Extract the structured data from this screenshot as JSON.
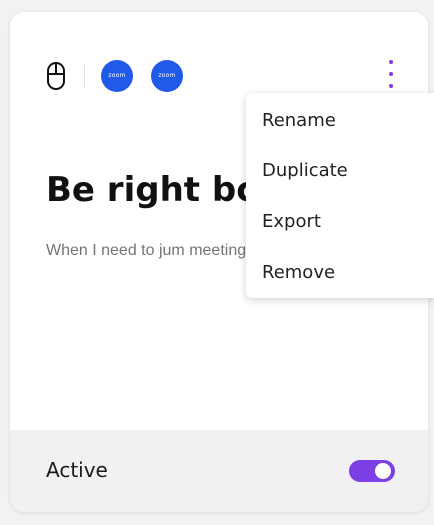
{
  "card": {
    "title": "Be right bc",
    "description": "When I need to jum meeting",
    "icons": [
      "mouse-icon",
      "zoom-app-icon",
      "zoom-app-icon",
      "more-vertical-icon"
    ],
    "app_icon_text": "zoom"
  },
  "menu": {
    "items": [
      {
        "label": "Rename"
      },
      {
        "label": "Duplicate"
      },
      {
        "label": "Export"
      },
      {
        "label": "Remove"
      }
    ]
  },
  "footer": {
    "status_label": "Active",
    "toggle_state": "on"
  },
  "colors": {
    "accent": "#7b3fe4",
    "app_icon_blue": "#1f5ae8",
    "card_background": "#ffffff",
    "footer_background": "#f1f1f3"
  }
}
